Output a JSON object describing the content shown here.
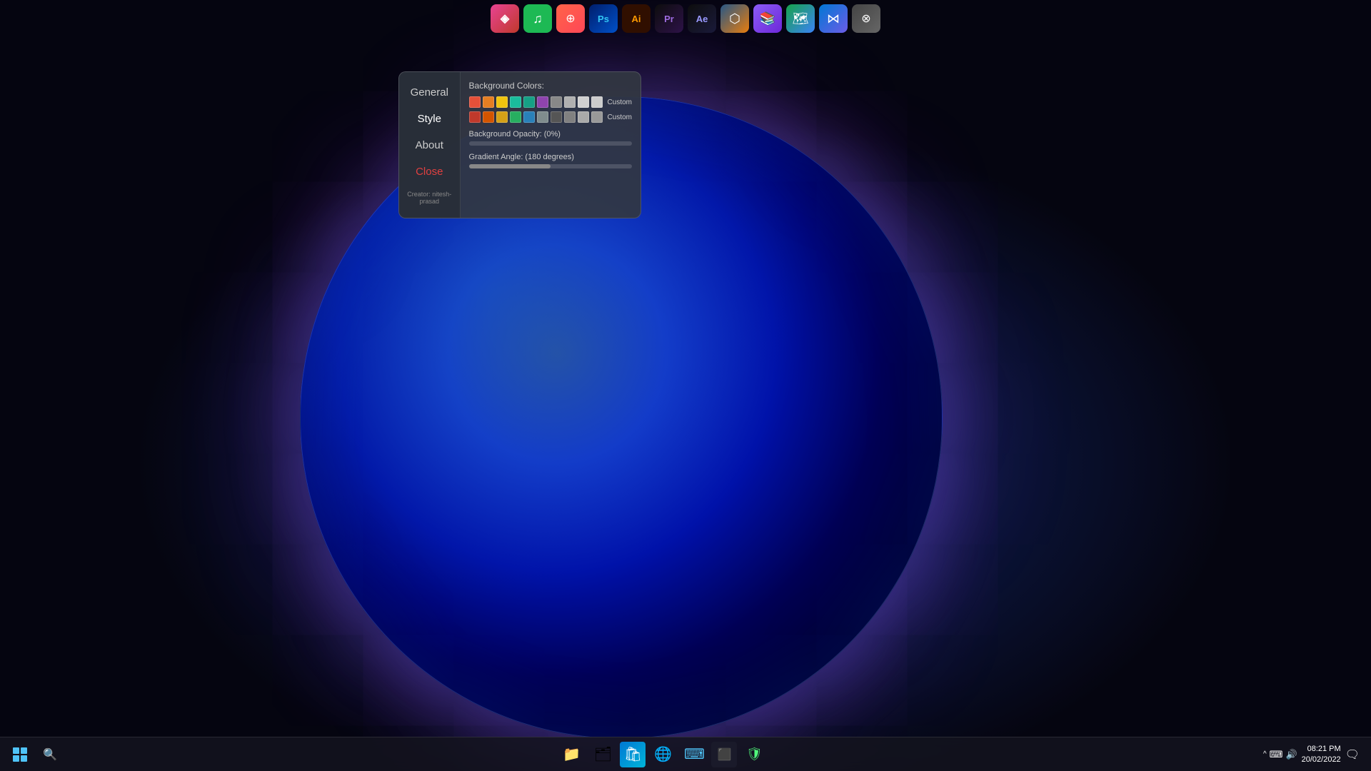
{
  "desktop": {
    "background_description": "Dark blue purple orb desktop"
  },
  "top_dock": {
    "apps": [
      {
        "id": "app1",
        "name": "Linear",
        "label": "◈",
        "color_class": "app-icon-1"
      },
      {
        "id": "app2",
        "name": "Spotify",
        "label": "♫",
        "color_class": "app-icon-2"
      },
      {
        "id": "app3",
        "name": "Creativit",
        "label": "⊕",
        "color_class": "app-icon-3"
      },
      {
        "id": "app4",
        "name": "Photoshop",
        "label": "Ps",
        "color_class": "app-icon-4"
      },
      {
        "id": "app5",
        "name": "Illustrator",
        "label": "Ai",
        "color_class": "app-icon-5"
      },
      {
        "id": "app6",
        "name": "Premiere",
        "label": "Pr",
        "color_class": "app-icon-6"
      },
      {
        "id": "app7",
        "name": "After Effects",
        "label": "Ae",
        "color_class": "app-icon-7"
      },
      {
        "id": "app8",
        "name": "Blender",
        "label": "⬡",
        "color_class": "app-icon-8"
      },
      {
        "id": "app9",
        "name": "Books",
        "label": "📚",
        "color_class": "app-icon-9"
      },
      {
        "id": "app10",
        "name": "Maps",
        "label": "📍",
        "color_class": "app-icon-10"
      },
      {
        "id": "app11",
        "name": "Visual Studio",
        "label": "⋈",
        "color_class": "app-icon-11"
      },
      {
        "id": "app12",
        "name": "Network",
        "label": "⊗",
        "color_class": "app-icon-1"
      }
    ]
  },
  "settings_panel": {
    "nav_items": [
      {
        "id": "general",
        "label": "General",
        "active": false
      },
      {
        "id": "style",
        "label": "Style",
        "active": true
      },
      {
        "id": "about",
        "label": "About",
        "active": false
      },
      {
        "id": "close",
        "label": "Close",
        "active": false,
        "is_close": true
      }
    ],
    "creator_text": "Creator: nitesh-prasad",
    "style_tab": {
      "bg_colors_label": "Background Colors:",
      "color_row1": [
        "#e55039",
        "#e67e22",
        "#f1c40f",
        "#1abc9c",
        "#16a085",
        "#8e44ad",
        "#888888",
        "#b0b0b0",
        "#d0d0d0"
      ],
      "color_row2": [
        "#c0392b",
        "#d35400",
        "#d4a017",
        "#27ae60",
        "#2980b9",
        "#7f8c8d",
        "#555555",
        "#808080",
        "#aaaaaa"
      ],
      "custom_label": "Custom",
      "custom_swatch1_color": "#cccccc",
      "custom_swatch2_color": "#999999",
      "opacity_label": "Background Opacity: (0%)",
      "opacity_value": 0,
      "opacity_fill_width": "0%",
      "gradient_label": "Gradient Angle: (180 degrees)",
      "gradient_value": 180,
      "gradient_fill_width": "50%"
    }
  },
  "taskbar": {
    "start_label": "⊞",
    "search_placeholder": "Search",
    "time": "08:21 PM",
    "date": "20/02/2022",
    "taskbar_icons": [
      {
        "id": "files",
        "label": "📁"
      },
      {
        "id": "explorer",
        "label": "🗂"
      },
      {
        "id": "store",
        "label": "🛍"
      },
      {
        "id": "chrome",
        "label": "🌐"
      },
      {
        "id": "vscode",
        "label": "⌨"
      },
      {
        "id": "terminal",
        "label": "⬛"
      },
      {
        "id": "security",
        "label": "🛡"
      }
    ],
    "tray": {
      "chevron": "^",
      "keyboard": "⌨",
      "volume": "🔊"
    }
  }
}
